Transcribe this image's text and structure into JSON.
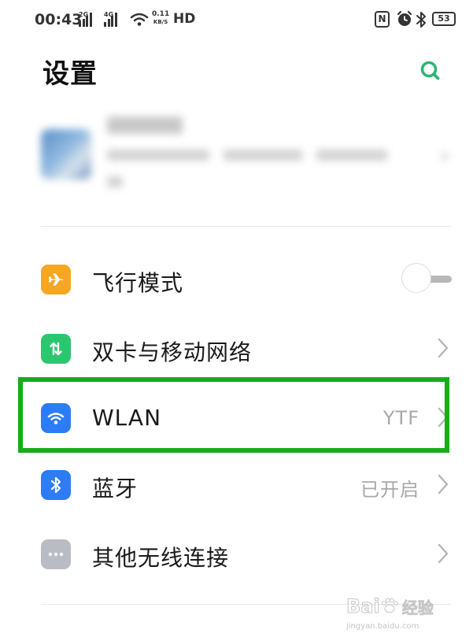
{
  "status_bar": {
    "time": "00:43",
    "sim1_tag": "2G",
    "sim2_tag": "4G",
    "net_speed_value": "0.11",
    "net_speed_unit": "KB/S",
    "hd_label": "HD",
    "nfc_label": "N",
    "battery_level": "53"
  },
  "header": {
    "title": "设置"
  },
  "settings": {
    "items": [
      {
        "id": "airplane",
        "label": "飞行模式",
        "value": "",
        "icon": "airplane-icon",
        "icon_color": "#f5a623",
        "control": "toggle",
        "toggle_on": false
      },
      {
        "id": "mobile-network",
        "label": "双卡与移动网络",
        "value": "",
        "icon": "mobile-data-icon",
        "icon_color": "#2bc76e",
        "control": "chevron"
      },
      {
        "id": "wlan",
        "label": "WLAN",
        "value": "YTF",
        "icon": "wifi-icon",
        "icon_color": "#2d7cf6",
        "control": "chevron"
      },
      {
        "id": "bluetooth",
        "label": "蓝牙",
        "value": "已开启",
        "icon": "bluetooth-icon",
        "icon_color": "#2d7cf6",
        "control": "chevron"
      },
      {
        "id": "other-wireless",
        "label": "其他无线连接",
        "value": "",
        "icon": "more-icon",
        "icon_color": "#b9bcc4",
        "control": "chevron"
      }
    ]
  },
  "highlight_color": "#16ad1c",
  "accent_color": "#2bb673",
  "watermark": {
    "brand": "Bai",
    "brand2": "经验",
    "url": "jingyan.baidu.com"
  }
}
